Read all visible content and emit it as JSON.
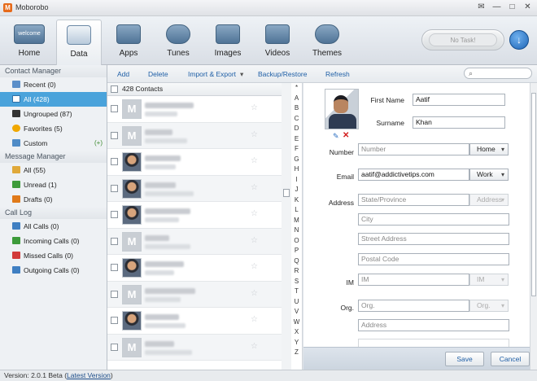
{
  "window": {
    "title": "Moborobo",
    "logo_text": "M",
    "min": "—",
    "max": "□",
    "close": "✕",
    "extra": "✉"
  },
  "toolbar": {
    "items": [
      {
        "label": "Home",
        "icon": "home-icon",
        "badge": "welcome"
      },
      {
        "label": "Data",
        "icon": "data-icon",
        "active": true
      },
      {
        "label": "Apps",
        "icon": "apps-icon"
      },
      {
        "label": "Tunes",
        "icon": "tunes-icon"
      },
      {
        "label": "Images",
        "icon": "images-icon"
      },
      {
        "label": "Videos",
        "icon": "videos-icon"
      },
      {
        "label": "Themes",
        "icon": "themes-icon"
      }
    ],
    "task_label": "No Task!",
    "download_glyph": "↓"
  },
  "sidebar": {
    "contact_manager": "Contact Manager",
    "contacts": [
      {
        "label": "Recent",
        "count": "(0)",
        "color": "#5b8fc9"
      },
      {
        "label": "All",
        "count": "(428)",
        "color": "#5b8fc9",
        "active": true
      },
      {
        "label": "Ungrouped",
        "count": "(87)",
        "color": "#333333"
      },
      {
        "label": "Favorites",
        "count": "(5)",
        "color": "#f0a800"
      },
      {
        "label": "Custom",
        "count": "",
        "color": "#4f8cc7",
        "extra": "(+)"
      }
    ],
    "message_manager": "Message Manager",
    "messages": [
      {
        "label": "All",
        "count": "(55)",
        "color": "#e0a93a"
      },
      {
        "label": "Unread",
        "count": "(1)",
        "color": "#3d9b3a"
      },
      {
        "label": "Drafts",
        "count": "(0)",
        "color": "#e07a1a"
      }
    ],
    "call_log": "Call Log",
    "calls": [
      {
        "label": "All Calls",
        "count": "(0)",
        "color": "#3f7fc2"
      },
      {
        "label": "Incoming Calls",
        "count": "(0)",
        "color": "#3d9b3a"
      },
      {
        "label": "Missed Calls",
        "count": "(0)",
        "color": "#d23a3a"
      },
      {
        "label": "Outgoing Calls",
        "count": "(0)",
        "color": "#3f7fc2"
      }
    ]
  },
  "commands": {
    "add": "Add",
    "delete": "Delete",
    "import_export": "Import & Export",
    "dropdown_glyph": "▾",
    "backup": "Backup/Restore",
    "refresh": "Refresh",
    "search_glyph": "⌕"
  },
  "contacts_list": {
    "header": "428 Contacts",
    "rows": [
      "m",
      "m",
      "p",
      "p",
      "p",
      "m",
      "p",
      "m",
      "p",
      "m"
    ],
    "star_glyph": "☆"
  },
  "alphabet": [
    "*",
    "A",
    "B",
    "C",
    "D",
    "E",
    "F",
    "G",
    "H",
    "I",
    "J",
    "K",
    "L",
    "M",
    "N",
    "O",
    "P",
    "Q",
    "R",
    "S",
    "T",
    "U",
    "V",
    "W",
    "X",
    "Y",
    "Z"
  ],
  "detail": {
    "edit_glyph": "✎",
    "delete_glyph": "✕",
    "first_name_label": "First Name",
    "first_name": "Aatif",
    "surname_label": "Surname",
    "surname": "Khan",
    "number_label": "Number",
    "number_placeholder": "Number",
    "number_type": "Home",
    "email_label": "Email",
    "email": "aatif@addictivetips.com",
    "email_type": "Work",
    "address_label": "Address",
    "state_placeholder": "State/Province",
    "address_type": "Address",
    "city_placeholder": "City",
    "street_placeholder": "Street Address",
    "postal_placeholder": "Postal Code",
    "im_label": "IM",
    "im_placeholder": "IM",
    "im_type": "IM",
    "org_label": "Org.",
    "org_placeholder": "Org.",
    "org_type": "Org.",
    "org_address_placeholder": "Address",
    "save": "Save",
    "cancel": "Cancel"
  },
  "status": {
    "version": "Version: 2.0.1 Beta",
    "latest": "Latest Version"
  }
}
